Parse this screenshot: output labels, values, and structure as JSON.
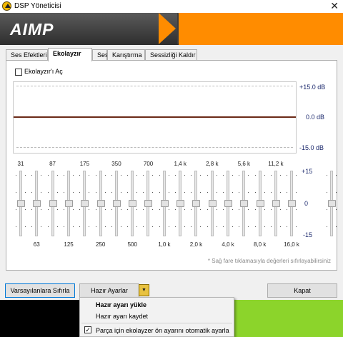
{
  "window": {
    "title": "DSP Yöneticisi",
    "close_glyph": "✕"
  },
  "banner": {
    "logo": "AIMP"
  },
  "tabs": [
    {
      "label": "Ses Efektleri"
    },
    {
      "label": "Ekolayzır"
    },
    {
      "label": "Ses"
    },
    {
      "label": "Karıştırma"
    },
    {
      "label": "Sessizliği Kaldır"
    }
  ],
  "equalizer": {
    "enable_label": "Ekolayzır'ı Aç",
    "enabled": false,
    "db_labels": [
      "+15.0 dB",
      "0.0 dB",
      "-15.0 dB"
    ],
    "scale_labels": [
      "+15",
      "0",
      "-15"
    ],
    "bands": [
      {
        "freq": "31",
        "value": 0
      },
      {
        "freq": "63",
        "value": 0
      },
      {
        "freq": "87",
        "value": 0
      },
      {
        "freq": "125",
        "value": 0
      },
      {
        "freq": "175",
        "value": 0
      },
      {
        "freq": "250",
        "value": 0
      },
      {
        "freq": "350",
        "value": 0
      },
      {
        "freq": "500",
        "value": 0
      },
      {
        "freq": "700",
        "value": 0
      },
      {
        "freq": "1,0 k",
        "value": 0
      },
      {
        "freq": "1,4 k",
        "value": 0
      },
      {
        "freq": "2,0 k",
        "value": 0
      },
      {
        "freq": "2,8 k",
        "value": 0
      },
      {
        "freq": "4,0 k",
        "value": 0
      },
      {
        "freq": "5,6 k",
        "value": 0
      },
      {
        "freq": "8,0 k",
        "value": 0
      },
      {
        "freq": "11,2 k",
        "value": 0
      },
      {
        "freq": "16,0 k",
        "value": 0
      }
    ],
    "preamp_value": 0,
    "hint": "* Sağ fare tıklamasıyla değerleri sıfırlayabilirsiniz"
  },
  "buttons": {
    "reset": "Varsayılanlara Sıfırla",
    "presets": "Hazır Ayarlar",
    "close": "Kapat",
    "dropdown_glyph": "▼"
  },
  "preset_menu": {
    "items": [
      "Hazır ayarı yükle",
      "Hazır ayarı kaydet"
    ],
    "auto_label": "Parça için ekolayzer ön ayarını otomatik ayarla",
    "auto_checked": true,
    "check_glyph": "✓"
  },
  "colors": {
    "accent": "#ff8c00",
    "eq_line": "#6b2a17",
    "db_text": "#1e2b6e",
    "green": "#8cd42b"
  }
}
